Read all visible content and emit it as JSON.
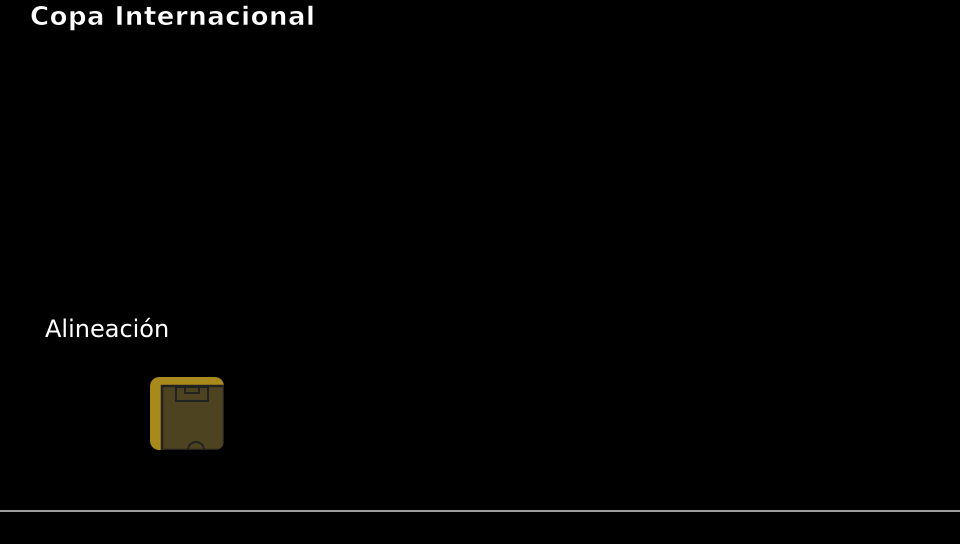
{
  "screen": {
    "title": "Copa Internacional"
  },
  "menu": {
    "section_label": "Alineación",
    "items": [
      {
        "icon": "soccer-field-icon",
        "state": "focused"
      }
    ]
  },
  "colors": {
    "background": "#000000",
    "tile_frame": "#a88a1c",
    "tile_inner": "#4e4320",
    "field_lines": "#222222",
    "divider": "#9c9c9c",
    "text": "#ffffff"
  }
}
